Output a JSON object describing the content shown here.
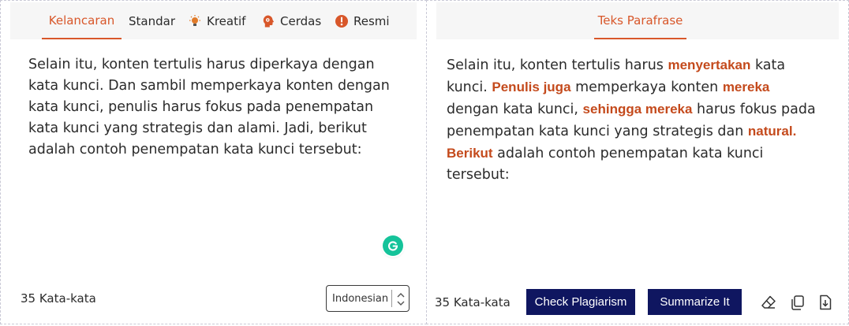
{
  "left_panel": {
    "tabs": [
      {
        "label": "Kelancaran",
        "icon": "",
        "active": true
      },
      {
        "label": "Standar",
        "icon": "",
        "active": false
      },
      {
        "label": "Kreatif",
        "icon": "bulb-icon",
        "active": false
      },
      {
        "label": "Cerdas",
        "icon": "brain-head-icon",
        "active": false
      },
      {
        "label": "Resmi",
        "icon": "formal-icon",
        "active": false
      }
    ],
    "input_text": "Selain itu, konten tertulis harus diperkaya dengan kata kunci. Dan sambil memperkaya konten dengan kata kunci, penulis harus fokus pada penempatan kata kunci yang strategis dan alami. Jadi, berikut adalah contoh penempatan kata kunci tersebut:",
    "word_count": "35 Kata-kata",
    "language": "Indonesian"
  },
  "right_panel": {
    "tab_label": "Teks Parafrase",
    "output_segments": [
      {
        "text": "Selain itu, konten tertulis harus ",
        "changed": false
      },
      {
        "text": "menyertakan",
        "changed": true
      },
      {
        "text": " kata kunci. ",
        "changed": false
      },
      {
        "text": "Penulis juga",
        "changed": true
      },
      {
        "text": " memperkaya konten ",
        "changed": false
      },
      {
        "text": "mereka",
        "changed": true
      },
      {
        "text": " dengan kata kunci, ",
        "changed": false
      },
      {
        "text": "sehingga mereka",
        "changed": true
      },
      {
        "text": " harus fokus pada penempatan kata kunci yang strategis dan ",
        "changed": false
      },
      {
        "text": "natural. Berikut",
        "changed": true
      },
      {
        "text": " adalah contoh penempatan kata kunci tersebut:",
        "changed": false
      }
    ],
    "word_count": "35 Kata-kata",
    "buttons": {
      "check_plagiarism": "Check Plagiarism",
      "summarize": "Summarize It"
    },
    "tools": [
      "eraser-icon",
      "copy-icon",
      "download-icon"
    ]
  },
  "colors": {
    "accent": "#d8572a",
    "highlight": "#c44a1c",
    "button": "#0f1660",
    "grammarly": "#15c39a"
  }
}
